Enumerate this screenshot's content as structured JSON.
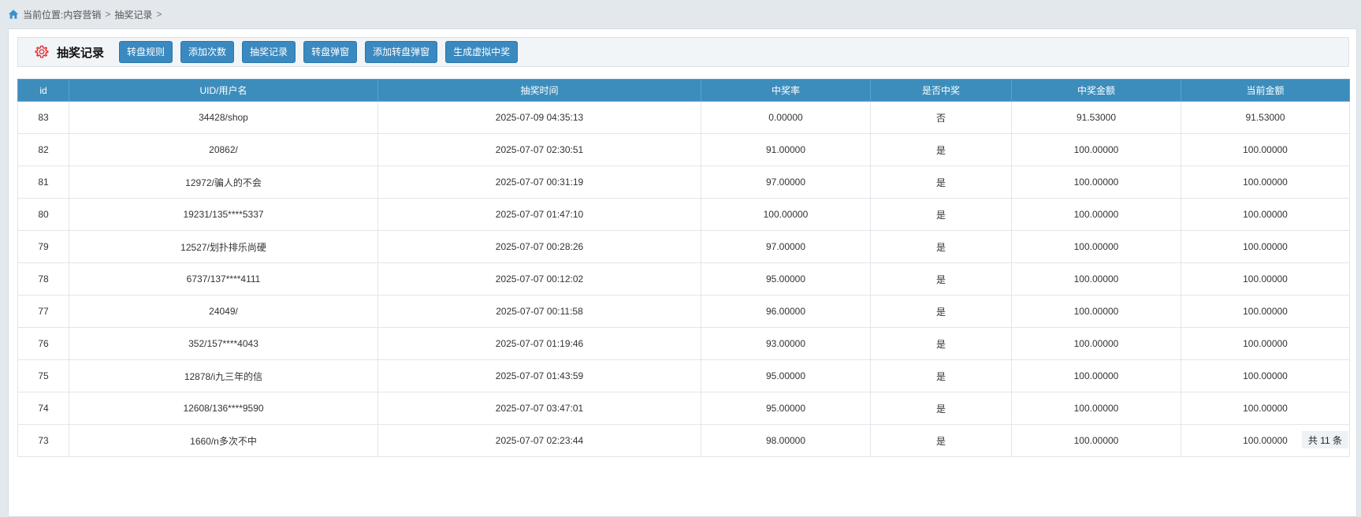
{
  "breadcrumb": {
    "prefix": "当前位置:",
    "items": [
      "内容营销",
      "抽奖记录"
    ],
    "separator": ">"
  },
  "toolbar": {
    "title": "抽奖记录",
    "buttons": [
      "转盘规则",
      "添加次数",
      "抽奖记录",
      "转盘弹窗",
      "添加转盘弹窗",
      "生成虚拟中奖"
    ]
  },
  "table": {
    "headers": [
      "id",
      "UID/用户名",
      "抽奖时间",
      "中奖率",
      "是否中奖",
      "中奖金额",
      "当前金额"
    ],
    "rows": [
      [
        "83",
        "34428/shop",
        "2025-07-09 04:35:13",
        "0.00000",
        "否",
        "91.53000",
        "91.53000"
      ],
      [
        "82",
        "20862/",
        "2025-07-07 02:30:51",
        "91.00000",
        "是",
        "100.00000",
        "100.00000"
      ],
      [
        "81",
        "12972/骗人的不会",
        "2025-07-07 00:31:19",
        "97.00000",
        "是",
        "100.00000",
        "100.00000"
      ],
      [
        "80",
        "19231/135****5337",
        "2025-07-07 01:47:10",
        "100.00000",
        "是",
        "100.00000",
        "100.00000"
      ],
      [
        "79",
        "12527/划扑排乐尚硬",
        "2025-07-07 00:28:26",
        "97.00000",
        "是",
        "100.00000",
        "100.00000"
      ],
      [
        "78",
        "6737/137****4111",
        "2025-07-07 00:12:02",
        "95.00000",
        "是",
        "100.00000",
        "100.00000"
      ],
      [
        "77",
        "24049/",
        "2025-07-07 00:11:58",
        "96.00000",
        "是",
        "100.00000",
        "100.00000"
      ],
      [
        "76",
        "352/157****4043",
        "2025-07-07 01:19:46",
        "93.00000",
        "是",
        "100.00000",
        "100.00000"
      ],
      [
        "75",
        "12878/i九三年的信",
        "2025-07-07 01:43:59",
        "95.00000",
        "是",
        "100.00000",
        "100.00000"
      ],
      [
        "74",
        "12608/136****9590",
        "2025-07-07 03:47:01",
        "95.00000",
        "是",
        "100.00000",
        "100.00000"
      ],
      [
        "73",
        "1660/n多次不中",
        "2025-07-07 02:23:44",
        "98.00000",
        "是",
        "100.00000",
        "100.00000"
      ]
    ]
  },
  "footer": {
    "total": "共 11 条"
  },
  "icons": {
    "breadcrumb": "home-icon",
    "title": "gear-icon"
  },
  "colors": {
    "accent": "#3c8dbc",
    "title_icon": "#e0343a"
  }
}
